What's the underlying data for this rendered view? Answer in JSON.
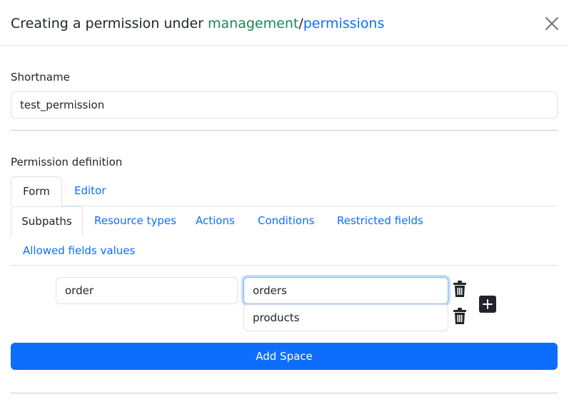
{
  "modal": {
    "title_prefix": "Creating a permission under ",
    "space_name": "management",
    "separator": "/",
    "subpath": "permissions",
    "close_icon": "close-icon"
  },
  "form": {
    "shortname_label": "Shortname",
    "shortname_value": "test_permission",
    "definition_label": "Permission definition"
  },
  "mode_tabs": [
    {
      "label": "Form",
      "active": true
    },
    {
      "label": "Editor",
      "active": false
    }
  ],
  "section_tabs": [
    {
      "label": "Subpaths",
      "active": true
    },
    {
      "label": "Resource types",
      "active": false
    },
    {
      "label": "Actions",
      "active": false
    },
    {
      "label": "Conditions",
      "active": false
    },
    {
      "label": "Restricted fields",
      "active": false
    },
    {
      "label": "Allowed fields values",
      "active": false
    }
  ],
  "subpaths": {
    "space_value": "order",
    "entries": [
      {
        "value": "orders",
        "focused": true,
        "delete_icon": "trash-icon"
      },
      {
        "value": "products",
        "focused": false,
        "delete_icon": "trash-icon"
      }
    ],
    "add_entry_icon": "plus-square-icon"
  },
  "buttons": {
    "add_space": "Add Space"
  },
  "colors": {
    "primary": "#0d6efd",
    "space_name": "#198754",
    "border": "#dee2e6"
  }
}
